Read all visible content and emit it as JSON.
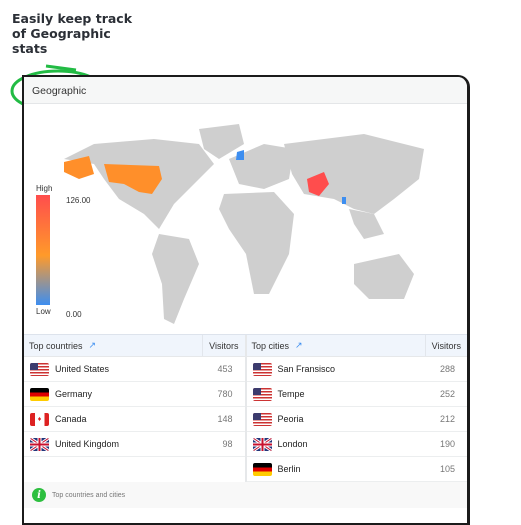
{
  "tagline": "Easily keep track of Geographic stats",
  "panel": {
    "title": "Geographic"
  },
  "legend": {
    "high_label": "High",
    "low_label": "Low",
    "max": "126.00",
    "min": "0.00"
  },
  "colors": {
    "accent": "#2dbf3f",
    "map_land": "#cfcfcf",
    "high": "#ff4d4d",
    "mid": "#ff9a2a",
    "low": "#3d8ef0"
  },
  "countries": {
    "title": "Top countries",
    "visitors_label": "Visitors",
    "rows": [
      {
        "flag": "us",
        "name": "United States",
        "visitors": "453"
      },
      {
        "flag": "de",
        "name": "Germany",
        "visitors": "780"
      },
      {
        "flag": "ca",
        "name": "Canada",
        "visitors": "148"
      },
      {
        "flag": "gb",
        "name": "United Kingdom",
        "visitors": "98"
      }
    ]
  },
  "cities": {
    "title": "Top cities",
    "visitors_label": "Visitors",
    "rows": [
      {
        "flag": "us",
        "name": "San Fransisco",
        "visitors": "288"
      },
      {
        "flag": "us",
        "name": "Tempe",
        "visitors": "252"
      },
      {
        "flag": "us",
        "name": "Peoria",
        "visitors": "212"
      },
      {
        "flag": "gb",
        "name": "London",
        "visitors": "190"
      },
      {
        "flag": "de",
        "name": "Berlin",
        "visitors": "105"
      }
    ]
  },
  "footer": {
    "text": "Top countries and cities",
    "icon": "info-icon"
  }
}
